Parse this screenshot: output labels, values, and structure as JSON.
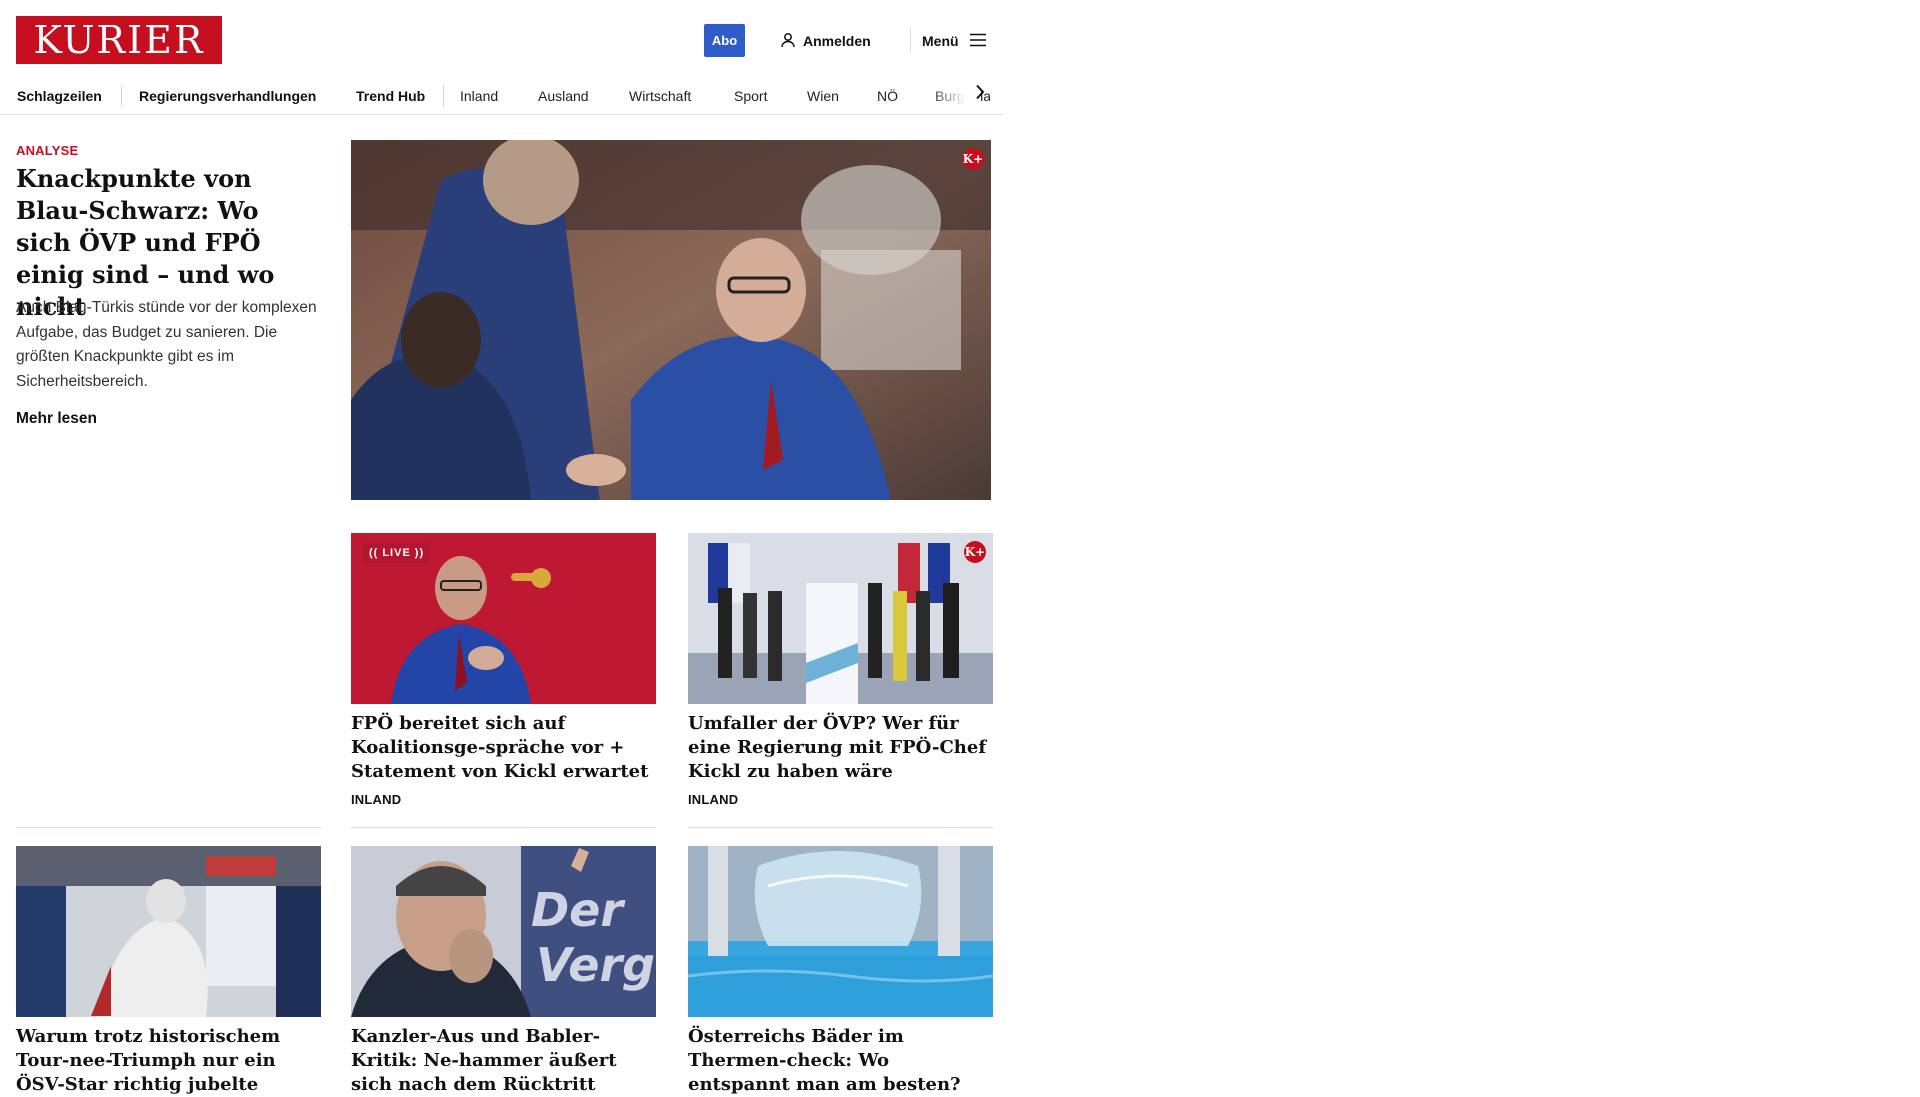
{
  "header": {
    "logo": "KURIER",
    "abo_label": "Abo",
    "login_label": "Anmelden",
    "menu_label": "Menü"
  },
  "nav": {
    "items": [
      "Schlagzeilen",
      "Regierungsverhandlungen",
      "Trend Hub",
      "Inland",
      "Ausland",
      "Wirtschaft",
      "Sport",
      "Wien",
      "NÖ",
      "Burgenland"
    ]
  },
  "lead": {
    "kicker": "ANALYSE",
    "title": "Knackpunkte von Blau-Schwarz: Wo sich ÖVP und FPÖ einig sind – und wo nicht",
    "teaser": "Auch Blau-Türkis stünde vor der komplexen Aufgabe, das Budget zu sanieren. Die größten Knackpunkte gibt es im Sicherheitsbereich.",
    "more_label": "Mehr lesen",
    "badge": "K+"
  },
  "cards_row1": [
    {
      "title": "FPÖ bereitet sich auf Koalitionsge-spräche vor + Statement von Kickl erwartet",
      "category": "INLAND",
      "live_label": "LIVE"
    },
    {
      "title": "Umfaller der ÖVP? Wer für eine Regierung mit FPÖ-Chef Kickl zu haben wäre",
      "category": "INLAND",
      "badge": "K+"
    }
  ],
  "cards_row2": [
    {
      "title": "Warum trotz historischem Tour-nee-Triumph nur ein ÖSV-Star richtig jubelte"
    },
    {
      "title": "Kanzler-Aus und Babler-Kritik: Ne-hammer äußert sich nach dem Rücktritt"
    },
    {
      "title": "Österreichs Bäder im Thermen-check: Wo entspannt man am besten?"
    }
  ],
  "colors": {
    "brand_red": "#c50f1f",
    "abo_blue": "#2f5cc8"
  }
}
